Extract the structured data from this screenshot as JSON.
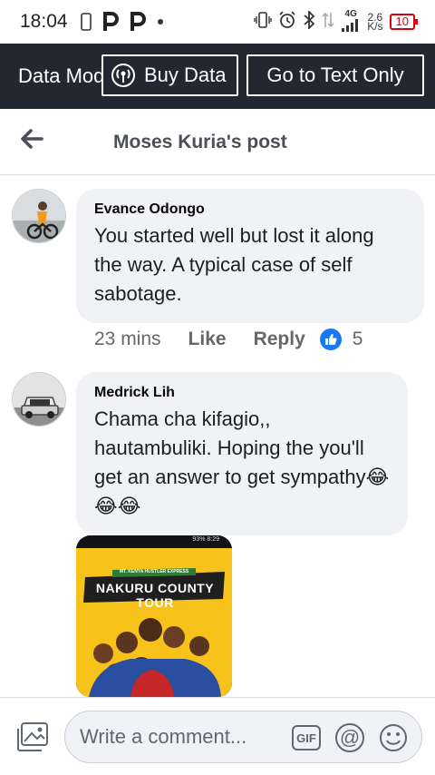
{
  "status_bar": {
    "time": "18:04",
    "network_type": "4G",
    "speed_value": "2.6",
    "speed_unit": "K/s",
    "battery": "10",
    "icons": [
      "sim-icon",
      "p-app-icon",
      "p-app-icon",
      "dot-icon",
      "vibrate-icon",
      "alarm-icon",
      "bluetooth-icon",
      "data-arrows-icon",
      "signal-icon",
      "battery-icon"
    ]
  },
  "data_bar": {
    "mode_label": "Data Mode",
    "buy_label": "Buy Data",
    "text_only_label": "Go to Text Only"
  },
  "header": {
    "title": "Moses Kuria's post"
  },
  "comments": [
    {
      "author": "Evance Odongo",
      "text": "You started well but lost it along the way. A typical case of self sabotage.",
      "time": "23 mins",
      "like_label": "Like",
      "reply_label": "Reply",
      "reaction_count": "5"
    },
    {
      "author": "Medrick Lih",
      "text": "Chama cha kifagio,, hautambuliki. Hoping the you'll get an answer to get sympathy😂😂😂"
    }
  ],
  "attachment": {
    "status_text": "93% 8:29",
    "banner_small": "MT. KENYA HUSTLER EXPRESS",
    "banner_title": "NAKURU COUNTY TOUR"
  },
  "composer": {
    "placeholder": "Write a comment...",
    "gif_label": "GIF",
    "at_label": "@"
  },
  "colors": {
    "data_bar_bg": "#222831",
    "bubble_bg": "#f0f2f5",
    "like_blue": "#1877f2",
    "meta_gray": "#65676b",
    "poster_yellow": "#f7c21a"
  }
}
